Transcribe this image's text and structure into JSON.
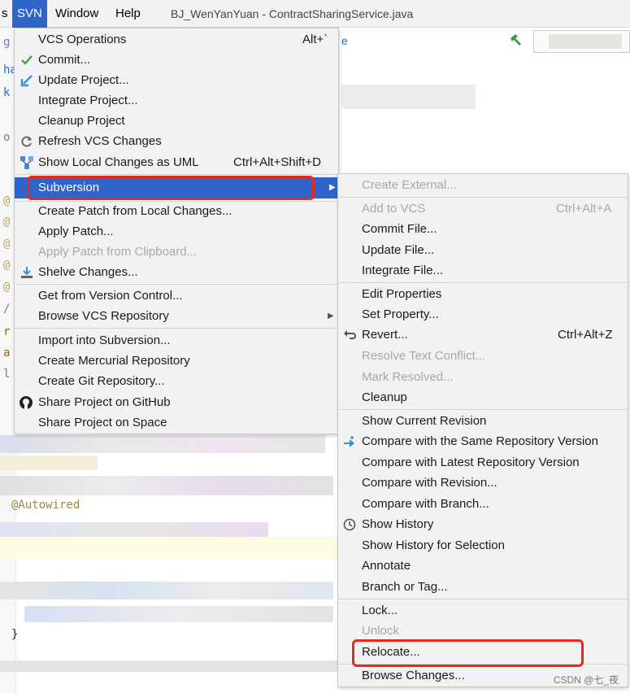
{
  "menubar": {
    "items": [
      {
        "label": "s"
      },
      {
        "label": "SVN"
      },
      {
        "label": "Window"
      },
      {
        "label": "Help"
      }
    ],
    "window_title": "BJ_WenYanYuan - ContractSharingService.java"
  },
  "editor": {
    "gutter_marks": [
      "g",
      "ha",
      "k",
      "o",
      "@",
      "@",
      "@",
      "@",
      "@",
      "/",
      "r",
      "a",
      "l"
    ],
    "annotation_text": "@Autowired",
    "closing_brace": "}",
    "fragment_e": "e"
  },
  "svn_menu": {
    "items": [
      {
        "label": "VCS Operations",
        "shortcut": "Alt+`"
      },
      {
        "label": "Commit...",
        "icon": "check-icon"
      },
      {
        "label": "Update Project...",
        "icon": "update-arrow-icon"
      },
      {
        "label": "Integrate Project..."
      },
      {
        "label": "Cleanup Project"
      },
      {
        "label": "Refresh VCS Changes",
        "icon": "refresh-icon"
      },
      {
        "label": "Show Local Changes as UML",
        "shortcut": "Ctrl+Alt+Shift+D",
        "icon": "uml-icon"
      },
      {
        "label": "Subversion",
        "selected": true
      },
      {
        "label": "Create Patch from Local Changes..."
      },
      {
        "label": "Apply Patch..."
      },
      {
        "label": "Apply Patch from Clipboard...",
        "disabled": true
      },
      {
        "label": "Shelve Changes...",
        "icon": "shelve-icon"
      },
      {
        "label": "Get from Version Control..."
      },
      {
        "label": "Browse VCS Repository"
      },
      {
        "label": "Import into Subversion..."
      },
      {
        "label": "Create Mercurial Repository"
      },
      {
        "label": "Create Git Repository..."
      },
      {
        "label": "Share Project on GitHub",
        "icon": "github-icon"
      },
      {
        "label": "Share Project on Space"
      }
    ]
  },
  "subversion_submenu": {
    "items": [
      {
        "label": "Create External...",
        "disabled": true
      },
      {
        "label": "Add to VCS",
        "shortcut": "Ctrl+Alt+A",
        "disabled": true
      },
      {
        "label": "Commit File..."
      },
      {
        "label": "Update File..."
      },
      {
        "label": "Integrate File..."
      },
      {
        "label": "Edit Properties"
      },
      {
        "label": "Set Property..."
      },
      {
        "label": "Revert...",
        "shortcut": "Ctrl+Alt+Z",
        "icon": "revert-icon"
      },
      {
        "label": "Resolve Text Conflict...",
        "disabled": true
      },
      {
        "label": "Mark Resolved...",
        "disabled": true
      },
      {
        "label": "Cleanup"
      },
      {
        "label": "Show Current Revision"
      },
      {
        "label": "Compare with the Same Repository Version",
        "icon": "compare-icon"
      },
      {
        "label": "Compare with Latest Repository Version"
      },
      {
        "label": "Compare with Revision..."
      },
      {
        "label": "Compare with Branch..."
      },
      {
        "label": "Show History",
        "icon": "clock-icon"
      },
      {
        "label": "Show History for Selection"
      },
      {
        "label": "Annotate"
      },
      {
        "label": "Branch or Tag..."
      },
      {
        "label": "Lock..."
      },
      {
        "label": "Unlock",
        "disabled": true
      },
      {
        "label": "Relocate..."
      },
      {
        "label": "Browse Changes..."
      }
    ]
  },
  "watermark": "CSDN @七_夜",
  "colors": {
    "selection": "#2f65ca",
    "highlight_box": "#e8291c",
    "menu_bg": "#f2f2f2",
    "disabled_text": "#a8a8a8"
  }
}
